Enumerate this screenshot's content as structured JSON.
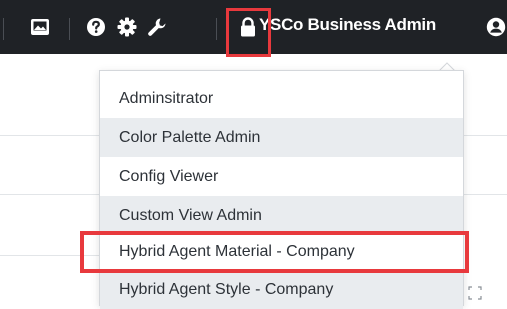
{
  "toolbar": {
    "account_label": "YSCo Business Admin",
    "icons": [
      "image-icon",
      "help-icon",
      "settings-gear-icon",
      "wrench-icon",
      "lock-icon",
      "user-account-icon"
    ],
    "background_color": "#1f2226",
    "highlight_color": "#e8393d"
  },
  "dropdown": {
    "items": [
      {
        "label": "Adminsitrator"
      },
      {
        "label": "Color Palette Admin"
      },
      {
        "label": "Config Viewer"
      },
      {
        "label": "Custom View Admin"
      },
      {
        "label": "Hybrid Agent Material - Company"
      },
      {
        "label": "Hybrid Agent Style - Company"
      }
    ],
    "highlighted_item": "Hybrid Agent Material - Company"
  }
}
